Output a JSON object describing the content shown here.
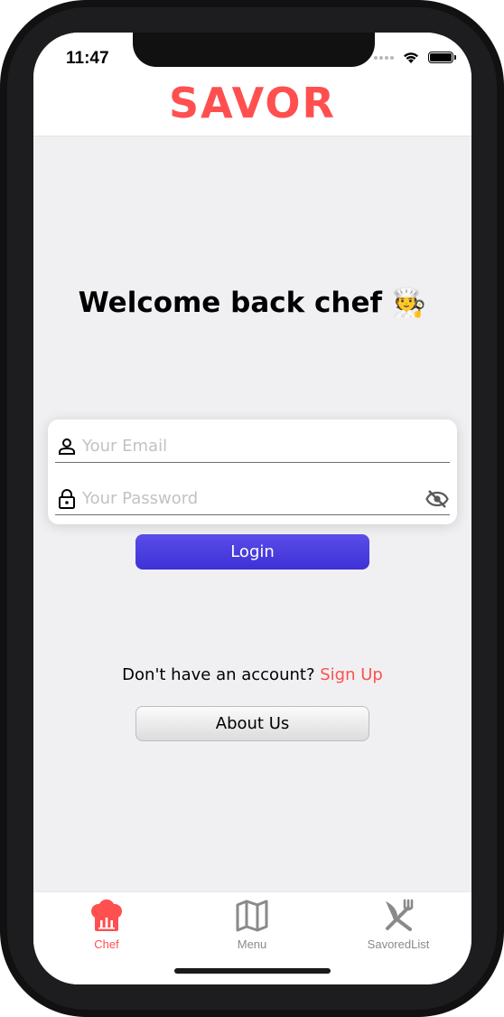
{
  "status_bar": {
    "time": "11:47",
    "icons": [
      "signal-icon",
      "wifi-icon",
      "battery-icon"
    ]
  },
  "header": {
    "title": "SAVOR"
  },
  "main": {
    "welcome_text": "Welcome back chef",
    "welcome_emoji": "🧑‍🍳",
    "email": {
      "placeholder": "Your Email",
      "value": "",
      "icon": "user-icon"
    },
    "password": {
      "placeholder": "Your Password",
      "value": "",
      "icon": "lock-icon",
      "toggle_icon": "eye-off-icon"
    },
    "login_label": "Login",
    "signup_prompt": "Don't have an account?",
    "signup_link": "Sign Up",
    "about_label": "About Us"
  },
  "tab_bar": {
    "tabs": [
      {
        "label": "Chef",
        "icon": "chef-hat-icon",
        "active": true
      },
      {
        "label": "Menu",
        "icon": "map-icon",
        "active": false
      },
      {
        "label": "SavoredList",
        "icon": "utensils-crossed-icon",
        "active": false
      }
    ]
  },
  "colors": {
    "brand": "#ff4f4f",
    "button_primary": "#4a3ee0",
    "background": "#f0f0f2",
    "inactive_tab": "#8a8a8a"
  }
}
